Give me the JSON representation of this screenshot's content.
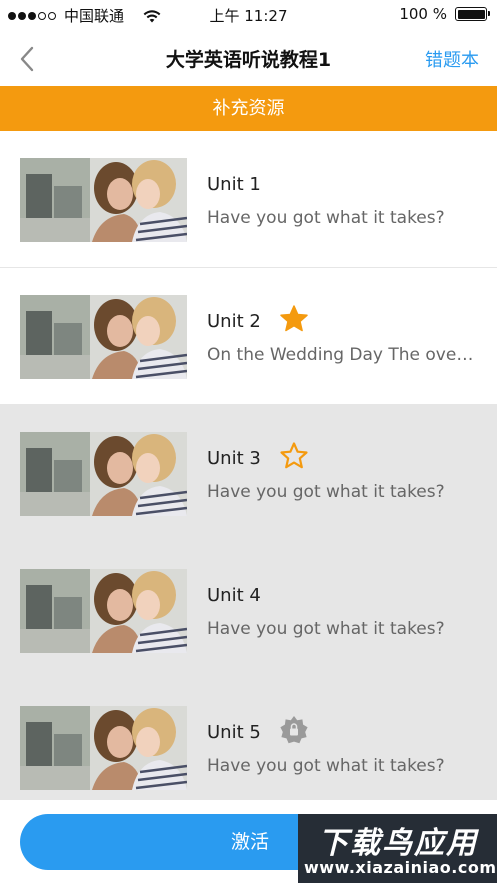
{
  "status_bar": {
    "carrier": "中国联通",
    "time": "上午 11:27",
    "battery": "100 %",
    "battery_level": 1.0
  },
  "nav": {
    "title": "大学英语听说教程1",
    "right_label": "错题本",
    "back_icon": "chevron-left-icon"
  },
  "banner": {
    "label": "补充资源"
  },
  "units": [
    {
      "title": "Unit 1",
      "description": "Have you got what it takes?",
      "icon": "",
      "state": "active"
    },
    {
      "title": "Unit 2",
      "description": "On the Wedding Day The overall...",
      "icon": "star-filled-icon",
      "state": "active"
    },
    {
      "title": "Unit 3",
      "description": "Have you got what it takes?",
      "icon": "star-outline-icon",
      "state": "locked"
    },
    {
      "title": "Unit 4",
      "description": "Have you got what it takes?",
      "icon": "",
      "state": "locked"
    },
    {
      "title": "Unit 5",
      "description": "Have you got what it takes?",
      "icon": "badge-lock-icon",
      "state": "locked"
    }
  ],
  "bottom": {
    "activate_label": "激活"
  },
  "watermark": {
    "top": "下载鸟应用",
    "bottom": "www.xiazainiao.com"
  },
  "colors": {
    "accent_blue": "#2a9bf0",
    "banner_orange": "#f49a0f",
    "star_orange": "#f49a0f",
    "locked_bg": "#e6e6e6"
  }
}
